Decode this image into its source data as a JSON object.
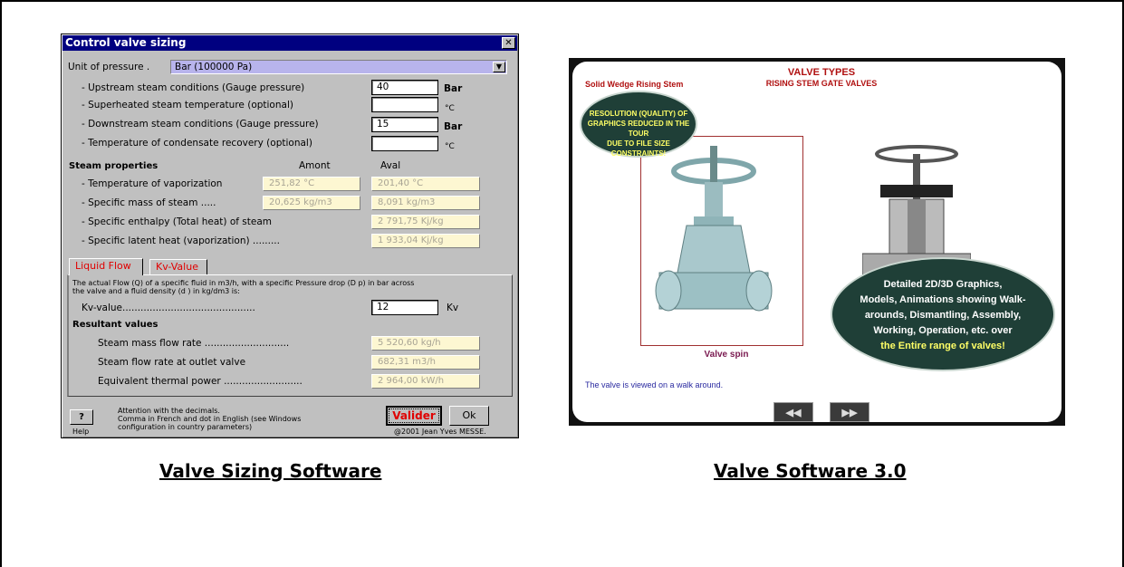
{
  "dialog": {
    "title": "Control valve sizing",
    "close_glyph": "✕",
    "unit_label": "Unit of pressure .",
    "unit_value": "Bar (100000 Pa)",
    "combo_arrow": "▼",
    "rows": [
      {
        "label": "- Upstream steam conditions (Gauge pressure)",
        "value": "40",
        "unit": "Bar"
      },
      {
        "label": "- Superheated steam temperature (optional)",
        "value": "",
        "unit": "°C"
      },
      {
        "label": "- Downstream steam conditions (Gauge pressure)",
        "value": "15",
        "unit": "Bar"
      },
      {
        "label": "- Temperature of condensate recovery (optional)",
        "value": "",
        "unit": "°C"
      }
    ],
    "steam_props_title": "Steam properties",
    "col_amont": "Amont",
    "col_aval": "Aval",
    "props": [
      {
        "label": "- Temperature of vaporization",
        "amont": "251,82 °C",
        "aval": "201,40 °C"
      },
      {
        "label": "- Specific mass of steam .....",
        "amont": "20,625 kg/m3",
        "aval": "8,091 kg/m3"
      },
      {
        "label": "- Specific enthalpy (Total heat) of steam",
        "aval": "2 791,75 Kj/kg"
      },
      {
        "label": "- Specific latent heat (vaporization) .........",
        "aval": "1 933,04 Kj/kg"
      }
    ],
    "tabs": [
      "Liquid Flow",
      "Kv-Value"
    ],
    "description_line1": "The actual Flow (Q) of a specific fluid in m3/h, with a specific Pressure drop (D p) in bar across",
    "description_line2": "the valve and a fluid density (d ) in kg/dm3 is:",
    "kv_label": "Kv-value............................................",
    "kv_value": "12",
    "kv_unit": "Kv",
    "resultant_title": "Resultant values",
    "results": [
      {
        "label": "Steam mass flow rate ............................",
        "value": "5 520,60 kg/h"
      },
      {
        "label": "Steam flow rate at outlet valve",
        "value": "682,31 m3/h"
      },
      {
        "label": "Equivalent thermal power ..........................",
        "value": "2 964,00 kW/h"
      }
    ],
    "help_glyph": "?",
    "help_label": "Help",
    "note_line1": "Attention with the decimals.",
    "note_line2": "Comma in French and dot in English (see Windows",
    "note_line3": "configuration in country parameters)",
    "validate_label": "Valider",
    "ok_label": "Ok",
    "copyright": "@2001 Jean Yves MESSE."
  },
  "valve_tour": {
    "title": "VALVE TYPES",
    "subtitle": "RISING STEM GATE VALVES",
    "top_left_label": "Solid Wedge Rising Stem",
    "notice_line1": "RESOLUTION (QUALITY) OF",
    "notice_line2": "GRAPHICS REDUCED IN THE TOUR",
    "notice_line3": "DUE TO FILE SIZE CONSTRAINTS!",
    "promo_line1": "Detailed 2D/3D Graphics,",
    "promo_line2": "Models, Animations showing Walk-",
    "promo_line3": "arounds, Dismantling, Assembly,",
    "promo_line4": "Working, Operation, etc. over",
    "promo_line5": "the Entire range of valves!",
    "valve_spin_label": "Valve spin",
    "footer_text": "The valve is viewed on a walk around.",
    "prev_glyph": "◀◀",
    "next_glyph": "▶▶"
  },
  "captions": {
    "left": "Valve Sizing Software",
    "right": "Valve Software 3.0"
  },
  "colors": {
    "titlebar": "#000080",
    "dialog_bg": "#c0c0c0",
    "combo_bg": "#b8b4ec",
    "readonly_bg": "#fdf7d2",
    "tab_red": "#e00000",
    "bubble_bg": "#1f3f37",
    "bubble_text": "#ffff66",
    "tour_red": "#b01010"
  }
}
